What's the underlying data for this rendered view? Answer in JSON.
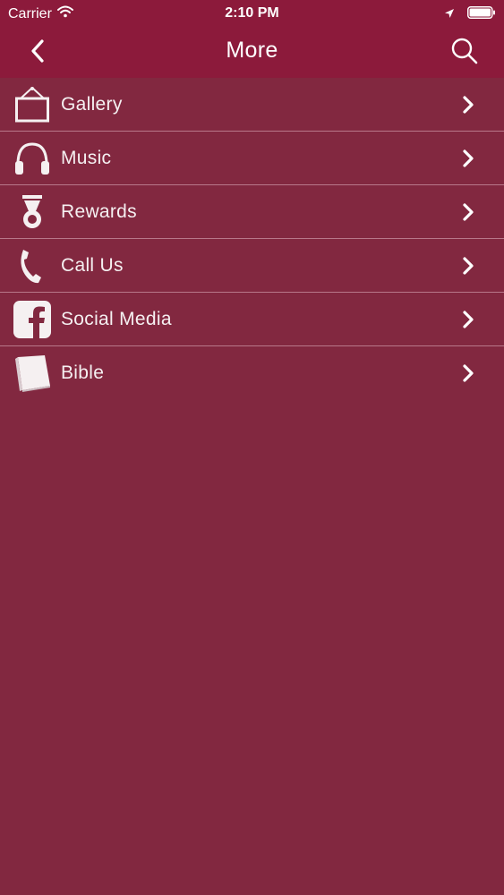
{
  "status_bar": {
    "carrier": "Carrier",
    "time": "2:10 PM"
  },
  "nav": {
    "title": "More"
  },
  "menu": {
    "items": [
      {
        "label": "Gallery",
        "icon": "picture-frame-icon"
      },
      {
        "label": "Music",
        "icon": "headphones-icon"
      },
      {
        "label": "Rewards",
        "icon": "medal-icon"
      },
      {
        "label": "Call Us",
        "icon": "phone-handset-icon"
      },
      {
        "label": "Social Media",
        "icon": "facebook-icon"
      },
      {
        "label": "Bible",
        "icon": "book-icon"
      }
    ]
  },
  "colors": {
    "header_bg": "#8c1a3b",
    "content_bg": "#822840",
    "divider": "#b8788a",
    "text": "#f5f0f1"
  }
}
